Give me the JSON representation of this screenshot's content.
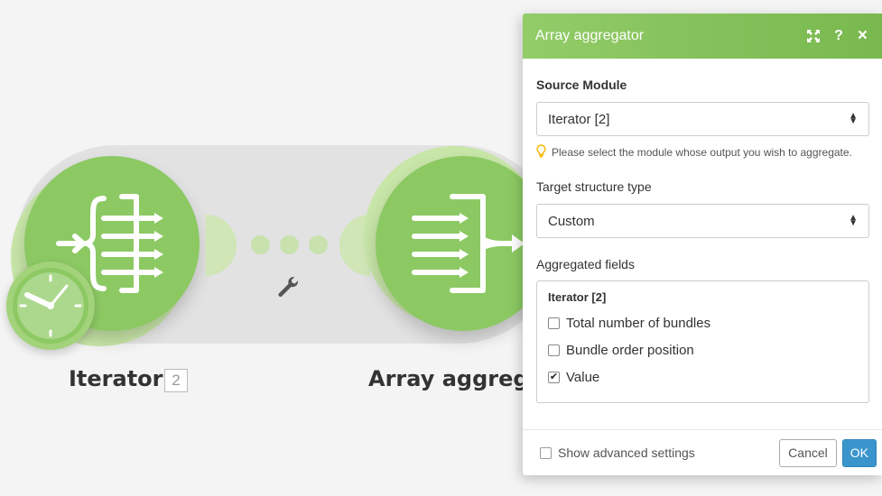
{
  "scenario": {
    "modules": [
      {
        "name": "Iterator",
        "badge": "2",
        "icon": "iterator-icon"
      },
      {
        "name": "Array aggrega",
        "icon": "array-aggregator-icon"
      }
    ],
    "connection_icon": "wrench-icon",
    "trigger_icon": "clock-icon"
  },
  "panel": {
    "title": "Array aggregator",
    "tools": {
      "fullscreen": "expand-icon",
      "help": "?",
      "close": "×"
    },
    "source_module": {
      "label": "Source Module",
      "value": "Iterator [2]",
      "hint": "Please select the module whose output you wish to aggregate."
    },
    "target_structure": {
      "label": "Target structure type",
      "value": "Custom"
    },
    "aggregated_fields": {
      "label": "Aggregated fields",
      "group": "Iterator [2]",
      "fields": [
        {
          "label": "Total number of bundles",
          "checked": false
        },
        {
          "label": "Bundle order position",
          "checked": false
        },
        {
          "label": "Value",
          "checked": true
        }
      ]
    },
    "footer": {
      "advanced_label": "Show advanced settings",
      "cancel_label": "Cancel",
      "ok_label": "OK"
    }
  },
  "colors": {
    "module_green": "#8cc963",
    "header_green": "#79b84f",
    "ok_blue": "#3a95cc",
    "hint_bulb": "#f5b800"
  }
}
